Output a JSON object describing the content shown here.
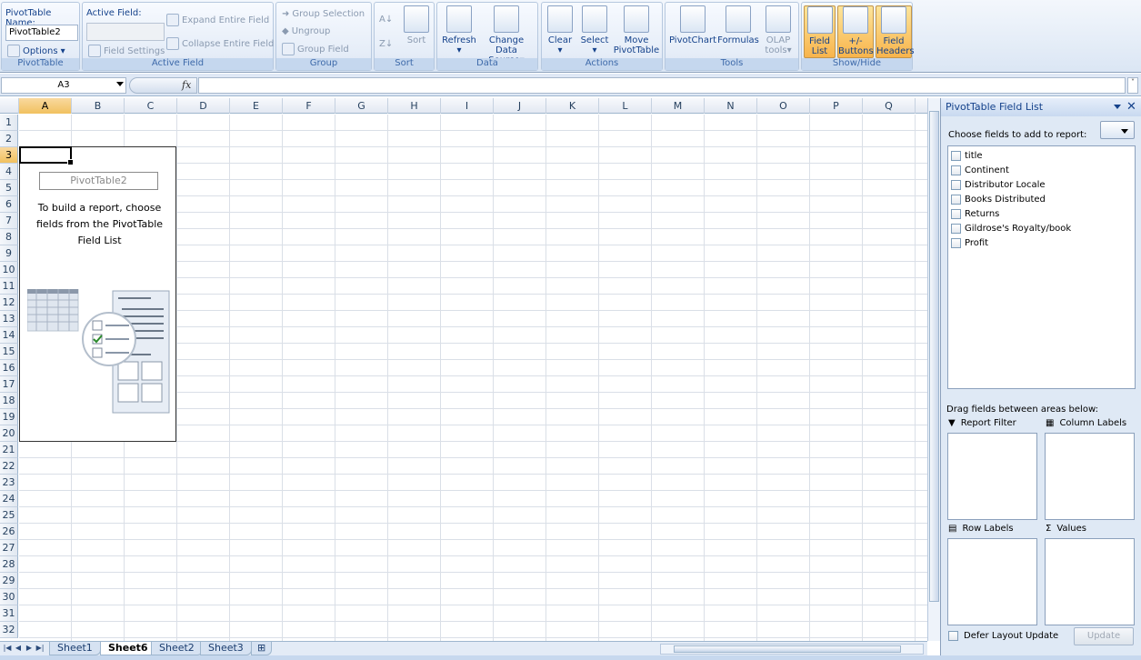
{
  "ribbon": {
    "pivottable": {
      "name_label": "PivotTable Name:",
      "name_value": "PivotTable2",
      "options_label": "Options",
      "group_label": "PivotTable"
    },
    "active_field": {
      "label": "Active Field:",
      "field_settings": "Field Settings",
      "expand": "Expand Entire Field",
      "collapse": "Collapse Entire Field",
      "group_label": "Active Field"
    },
    "group": {
      "group_selection": "Group Selection",
      "ungroup": "Ungroup",
      "group_field": "Group Field",
      "group_label": "Group"
    },
    "sort": {
      "sort": "Sort",
      "group_label": "Sort"
    },
    "data": {
      "refresh": "Refresh",
      "change_source_1": "Change Data",
      "change_source_2": "Source",
      "group_label": "Data"
    },
    "actions": {
      "clear": "Clear",
      "select": "Select",
      "move_1": "Move",
      "move_2": "PivotTable",
      "group_label": "Actions"
    },
    "tools": {
      "pivotchart": "PivotChart",
      "formulas": "Formulas",
      "olap_1": "OLAP",
      "olap_2": "tools",
      "group_label": "Tools"
    },
    "showhide": {
      "field_list_1": "Field",
      "field_list_2": "List",
      "buttons_1": "+/-",
      "buttons_2": "Buttons",
      "headers_1": "Field",
      "headers_2": "Headers",
      "group_label": "Show/Hide"
    }
  },
  "formula_bar": {
    "name_box": "A3",
    "fx": "fx",
    "expand": "˅"
  },
  "grid": {
    "columns": [
      "A",
      "B",
      "C",
      "D",
      "E",
      "F",
      "G",
      "H",
      "I",
      "J",
      "K",
      "L",
      "M",
      "N",
      "O",
      "P",
      "Q"
    ],
    "rows": [
      "1",
      "2",
      "3",
      "4",
      "5",
      "6",
      "7",
      "8",
      "9",
      "10",
      "11",
      "12",
      "13",
      "14",
      "15",
      "16",
      "17",
      "18",
      "19",
      "20",
      "21",
      "22",
      "23",
      "24",
      "25",
      "26",
      "27",
      "28",
      "29",
      "30",
      "31",
      "32"
    ],
    "selected_column": "A",
    "selected_row": "3"
  },
  "pivot_placeholder": {
    "title": "PivotTable2",
    "instructions": "To build a report, choose fields from the PivotTable Field List"
  },
  "sheets": {
    "tabs": [
      "Sheet1",
      "Sheet6",
      "Sheet2",
      "Sheet3"
    ],
    "active": "Sheet6"
  },
  "field_list": {
    "title": "PivotTable Field List",
    "choose_label": "Choose fields to add to report:",
    "fields": [
      "title",
      "Continent",
      "Distributor Locale",
      "Books Distributed",
      "Returns",
      "Gildrose's Royalty/book",
      "Profit"
    ],
    "drag_label": "Drag fields between areas below:",
    "areas": {
      "report_filter": "Report Filter",
      "column_labels": "Column Labels",
      "row_labels": "Row Labels",
      "values": "Values"
    },
    "defer_label": "Defer Layout Update",
    "update_button": "Update"
  },
  "colors": {
    "ribbon_bg": "#dbe6f4",
    "selected_header": "#f1c15f",
    "active_toggle": "#f8b44c",
    "text_blue": "#15428b"
  }
}
